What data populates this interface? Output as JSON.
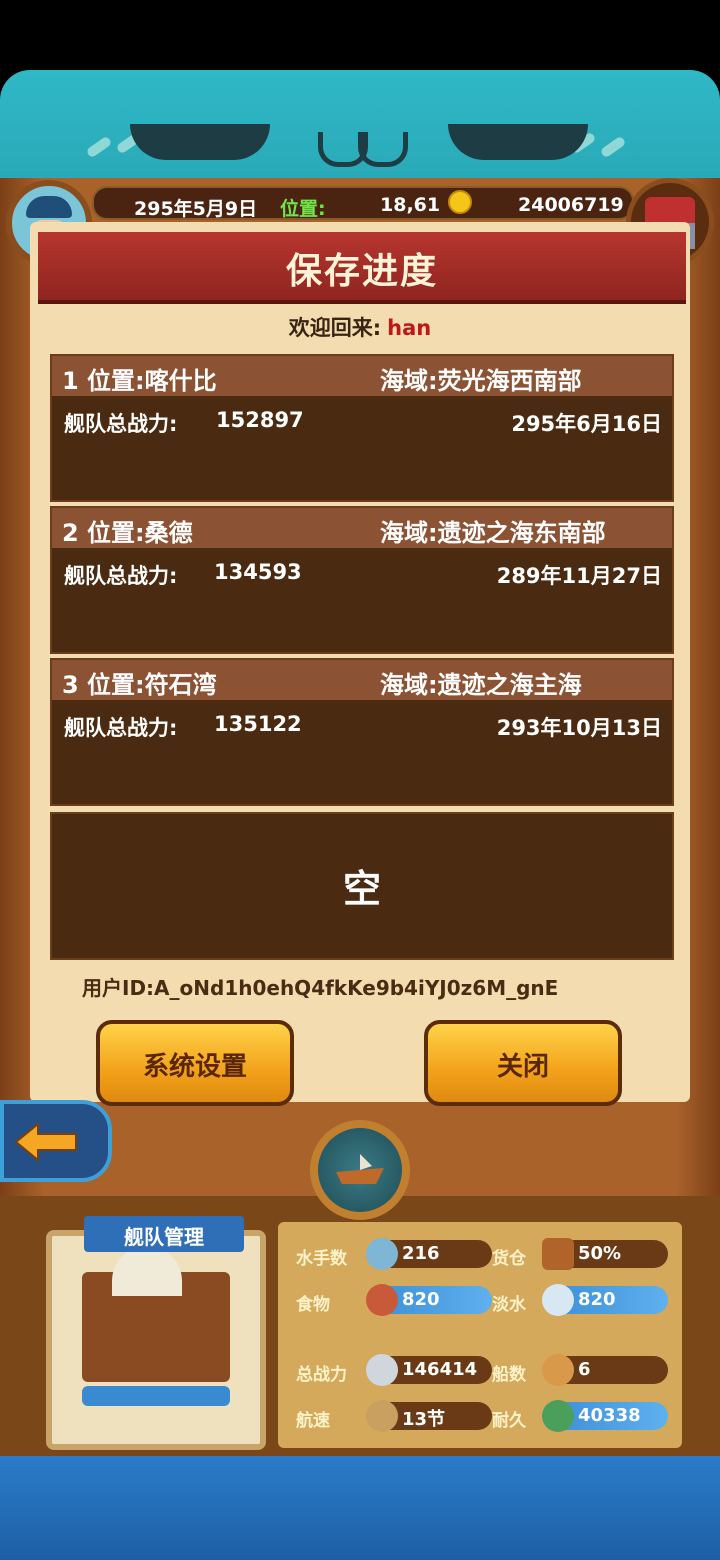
{
  "status": {
    "date": "295年5月9日",
    "location_label": "位置:",
    "coords": "18,61",
    "gold": "24006719"
  },
  "dialog": {
    "title": "保存进度",
    "welcome_prefix": "欢迎回来:",
    "username": "han",
    "slots": [
      {
        "head_left": "1 位置:喀什比",
        "head_right": "海域:荧光海西南部",
        "power_label": "舰队总战力:",
        "power": "152897",
        "date": "295年6月16日"
      },
      {
        "head_left": "2 位置:桑德",
        "head_right": "海域:遗迹之海东南部",
        "power_label": "舰队总战力:",
        "power": "134593",
        "date": "289年11月27日"
      },
      {
        "head_left": "3 位置:符石湾",
        "head_right": "海域:遗迹之海主海",
        "power_label": "舰队总战力:",
        "power": "135122",
        "date": "293年10月13日"
      }
    ],
    "empty_slot": "空",
    "user_id": "用户ID:A_oNd1h0ehQ4fkKe9b4iYJ0z6M_gnE",
    "settings_button": "系统设置",
    "close_button": "关闭"
  },
  "fleet": {
    "panel_title": "舰队管理",
    "sailors_label": "水手数",
    "sailors": "216",
    "cargo_label": "货仓",
    "cargo": "50%",
    "food_label": "食物",
    "food": "820",
    "water_label": "淡水",
    "water": "820",
    "power_label": "总战力",
    "power": "146414",
    "ships_label": "船数",
    "ships": "6",
    "speed_label": "航速",
    "speed": "13节",
    "durability_label": "耐久",
    "durability": "40338"
  },
  "colors": {
    "accent_red": "#b7362f",
    "slot_dark": "#4a2a10",
    "button_gold": "#f2a21a",
    "username_red": "#c01818"
  }
}
